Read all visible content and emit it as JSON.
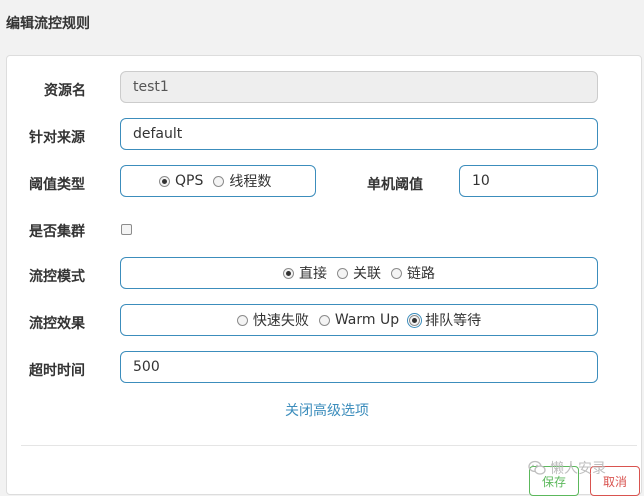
{
  "dialog": {
    "title": "编辑流控规则"
  },
  "form": {
    "resource": {
      "label": "资源名",
      "value": "test1"
    },
    "origin": {
      "label": "针对来源",
      "value": "default"
    },
    "threshold_type": {
      "label": "阈值类型",
      "options": [
        "QPS",
        "线程数"
      ],
      "selected": "QPS"
    },
    "single_threshold": {
      "label": "单机阈值",
      "value": "10"
    },
    "cluster": {
      "label": "是否集群",
      "checked": false
    },
    "flow_mode": {
      "label": "流控模式",
      "options": [
        "直接",
        "关联",
        "链路"
      ],
      "selected": "直接"
    },
    "flow_effect": {
      "label": "流控效果",
      "options": [
        "快速失败",
        "Warm Up",
        "排队等待"
      ],
      "selected": "排队等待"
    },
    "timeout": {
      "label": "超时时间",
      "value": "500"
    },
    "advanced_toggle": "关闭高级选项"
  },
  "footer": {
    "save": "保存",
    "cancel": "取消"
  },
  "watermark": "懒人安录",
  "colors": {
    "accent": "#3c8dbc",
    "save": "#5cb85c",
    "cancel": "#d9534f"
  }
}
